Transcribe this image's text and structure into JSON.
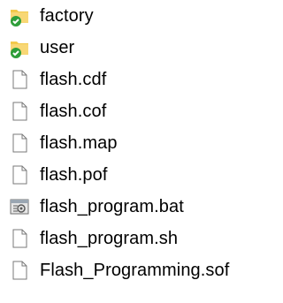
{
  "explorer": {
    "items": [
      {
        "name": "factory",
        "icon": "folder-synced-icon",
        "type": "folder"
      },
      {
        "name": "user",
        "icon": "folder-synced-icon",
        "type": "folder"
      },
      {
        "name": "flash.cdf",
        "icon": "file-icon",
        "type": "file"
      },
      {
        "name": "flash.cof",
        "icon": "file-icon",
        "type": "file"
      },
      {
        "name": "flash.map",
        "icon": "file-icon",
        "type": "file"
      },
      {
        "name": "flash.pof",
        "icon": "file-icon",
        "type": "file"
      },
      {
        "name": "flash_program.bat",
        "icon": "batch-file-icon",
        "type": "batch"
      },
      {
        "name": "flash_program.sh",
        "icon": "file-icon",
        "type": "file"
      },
      {
        "name": "Flash_Programming.sof",
        "icon": "file-icon",
        "type": "file"
      }
    ]
  },
  "colors": {
    "folder": "#f2c94c",
    "sync_check": "#2e9e3a",
    "file_outline": "#7a7a7a",
    "text": "#000000"
  }
}
